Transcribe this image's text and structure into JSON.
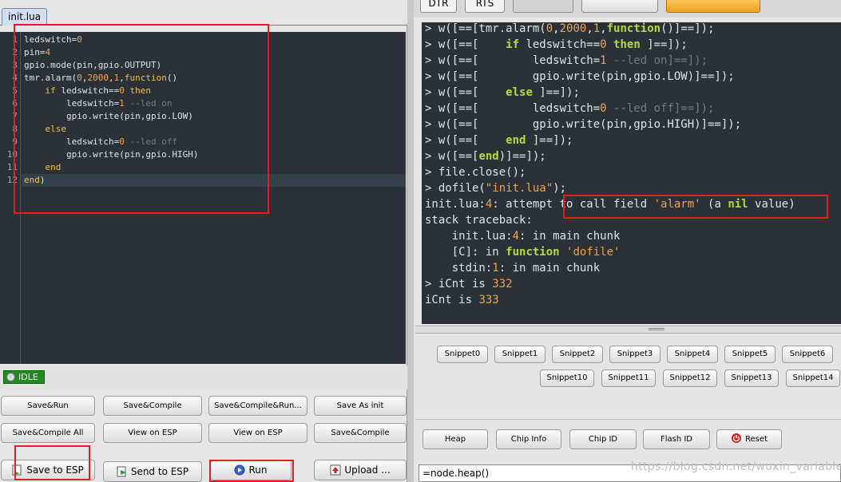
{
  "left": {
    "tab_label": "init.lua",
    "code_lines": [
      {
        "n": "1",
        "parts": [
          {
            "t": "ledswitch=",
            "c": ""
          },
          {
            "t": "0",
            "c": "num"
          }
        ]
      },
      {
        "n": "2",
        "parts": [
          {
            "t": "pin=",
            "c": ""
          },
          {
            "t": "4",
            "c": "num"
          }
        ]
      },
      {
        "n": "3",
        "parts": [
          {
            "t": "gpio.mode(pin,gpio.OUTPUT)",
            "c": ""
          }
        ]
      },
      {
        "n": "4",
        "parts": [
          {
            "t": "tmr.alarm(",
            "c": ""
          },
          {
            "t": "0",
            "c": "num"
          },
          {
            "t": ",",
            "c": ""
          },
          {
            "t": "2000",
            "c": "num"
          },
          {
            "t": ",",
            "c": ""
          },
          {
            "t": "1",
            "c": "num"
          },
          {
            "t": ",",
            "c": ""
          },
          {
            "t": "function",
            "c": "kw"
          },
          {
            "t": "()",
            "c": ""
          }
        ]
      },
      {
        "n": "5",
        "parts": [
          {
            "t": "    ",
            "c": ""
          },
          {
            "t": "if",
            "c": "kw"
          },
          {
            "t": " ledswitch==",
            "c": ""
          },
          {
            "t": "0",
            "c": "num"
          },
          {
            "t": " ",
            "c": ""
          },
          {
            "t": "then",
            "c": "kw"
          }
        ]
      },
      {
        "n": "6",
        "parts": [
          {
            "t": "        ledswitch=",
            "c": ""
          },
          {
            "t": "1",
            "c": "num"
          },
          {
            "t": " --led on",
            "c": "cm"
          }
        ]
      },
      {
        "n": "7",
        "parts": [
          {
            "t": "        gpio.write(pin,gpio.LOW)",
            "c": ""
          }
        ]
      },
      {
        "n": "8",
        "parts": [
          {
            "t": "    ",
            "c": ""
          },
          {
            "t": "else",
            "c": "kw"
          }
        ]
      },
      {
        "n": "9",
        "parts": [
          {
            "t": "        ledswitch=",
            "c": ""
          },
          {
            "t": "0",
            "c": "num"
          },
          {
            "t": " --led off",
            "c": "cm"
          }
        ]
      },
      {
        "n": "10",
        "parts": [
          {
            "t": "        gpio.write(pin,gpio.HIGH)",
            "c": ""
          }
        ]
      },
      {
        "n": "11",
        "parts": [
          {
            "t": "    ",
            "c": ""
          },
          {
            "t": "end",
            "c": "kw"
          }
        ]
      },
      {
        "n": "12",
        "parts": [
          {
            "t": "end",
            "c": "kw"
          },
          {
            "t": ")",
            "c": ""
          }
        ]
      }
    ],
    "status": "IDLE",
    "buttons": {
      "save_run": "Save&Run",
      "save_compile": "Save&Compile",
      "save_compile_run": "Save&Compile&Run...",
      "save_as_init": "Save As init",
      "save_compile_all": "Save&Compile All",
      "view_on_esp_1": "View on ESP",
      "view_on_esp_2": "View on ESP",
      "save_compile_2": "Save&Compile",
      "save_to_esp": "Save to ESP",
      "send_to_esp": "Send to ESP",
      "run": "Run",
      "upload": "Upload ..."
    }
  },
  "right": {
    "top_buttons": {
      "dtr": "DTR",
      "rts": "RTS"
    },
    "console_lines": [
      {
        "parts": [
          {
            "t": "> w([==[tmr.alarm(",
            "c": ""
          },
          {
            "t": "0",
            "c": "nm"
          },
          {
            "t": ",",
            "c": ""
          },
          {
            "t": "2000",
            "c": "nm"
          },
          {
            "t": ",",
            "c": ""
          },
          {
            "t": "1",
            "c": "nm"
          },
          {
            "t": ",",
            "c": ""
          },
          {
            "t": "function",
            "c": "kwb"
          },
          {
            "t": "()]==]);",
            "c": ""
          }
        ]
      },
      {
        "parts": [
          {
            "t": "> w([==[    ",
            "c": ""
          },
          {
            "t": "if",
            "c": "kwb"
          },
          {
            "t": " ledswitch==",
            "c": ""
          },
          {
            "t": "0",
            "c": "nm"
          },
          {
            "t": " ",
            "c": ""
          },
          {
            "t": "then",
            "c": "kwb"
          },
          {
            "t": " ]==]);",
            "c": ""
          }
        ]
      },
      {
        "parts": [
          {
            "t": "> w([==[        ledswitch=",
            "c": ""
          },
          {
            "t": "1",
            "c": "nm"
          },
          {
            "t": " --led on]==]);",
            "c": "gr"
          }
        ]
      },
      {
        "parts": [
          {
            "t": "> w([==[        gpio.write(pin,gpio.LOW)]==]);",
            "c": ""
          }
        ]
      },
      {
        "parts": [
          {
            "t": "> w([==[    ",
            "c": ""
          },
          {
            "t": "else",
            "c": "kwb"
          },
          {
            "t": " ]==]);",
            "c": ""
          }
        ]
      },
      {
        "parts": [
          {
            "t": "> w([==[        ledswitch=",
            "c": ""
          },
          {
            "t": "0",
            "c": "nm"
          },
          {
            "t": " --led off]==]);",
            "c": "gr"
          }
        ]
      },
      {
        "parts": [
          {
            "t": "> w([==[        gpio.write(pin,gpio.HIGH)]==]);",
            "c": ""
          }
        ]
      },
      {
        "parts": [
          {
            "t": "> w([==[    ",
            "c": ""
          },
          {
            "t": "end",
            "c": "kwb"
          },
          {
            "t": " ]==]);",
            "c": ""
          }
        ]
      },
      {
        "parts": [
          {
            "t": "> w([==[",
            "c": ""
          },
          {
            "t": "end",
            "c": "kwb"
          },
          {
            "t": ")]==]);",
            "c": ""
          }
        ]
      },
      {
        "parts": [
          {
            "t": "> file.close();",
            "c": ""
          }
        ]
      },
      {
        "parts": [
          {
            "t": "> dofile(",
            "c": ""
          },
          {
            "t": "\"init.lua\"",
            "c": "str"
          },
          {
            "t": ");",
            "c": ""
          }
        ]
      },
      {
        "parts": [
          {
            "t": "init.lua:",
            "c": ""
          },
          {
            "t": "4",
            "c": "nm"
          },
          {
            "t": ": attempt to call field ",
            "c": ""
          },
          {
            "t": "'alarm'",
            "c": "str"
          },
          {
            "t": " (a ",
            "c": ""
          },
          {
            "t": "nil",
            "c": "nil"
          },
          {
            "t": " value)",
            "c": ""
          }
        ]
      },
      {
        "parts": [
          {
            "t": "stack traceback:",
            "c": ""
          }
        ]
      },
      {
        "parts": [
          {
            "t": "    init.lua:",
            "c": ""
          },
          {
            "t": "4",
            "c": "nm"
          },
          {
            "t": ": in main chunk",
            "c": ""
          }
        ]
      },
      {
        "parts": [
          {
            "t": "    [C]: in ",
            "c": ""
          },
          {
            "t": "function",
            "c": "kwb"
          },
          {
            "t": " ",
            "c": ""
          },
          {
            "t": "'dofile'",
            "c": "str"
          }
        ]
      },
      {
        "parts": [
          {
            "t": "    stdin:",
            "c": ""
          },
          {
            "t": "1",
            "c": "nm"
          },
          {
            "t": ": in main chunk",
            "c": ""
          }
        ]
      },
      {
        "parts": [
          {
            "t": "> iCnt is ",
            "c": ""
          },
          {
            "t": "332",
            "c": "nm"
          }
        ]
      },
      {
        "parts": [
          {
            "t": "iCnt is ",
            "c": ""
          },
          {
            "t": "333",
            "c": "nm"
          }
        ]
      }
    ],
    "snippets_row1": [
      "Snippet0",
      "Snippet1",
      "Snippet2",
      "Snippet3",
      "Snippet4",
      "Snippet5",
      "Snippet6"
    ],
    "snippets_row2": [
      "Snippet10",
      "Snippet11",
      "Snippet12",
      "Snippet13",
      "Snippet14"
    ],
    "bottom_buttons": {
      "heap": "Heap",
      "chip_info": "Chip Info",
      "chip_id": "Chip ID",
      "flash_id": "Flash ID",
      "reset": "Reset"
    },
    "command_value": "=node.heap()",
    "watermark": "https://blog.csdn.net/wuxin_variable"
  },
  "colors": {
    "editor_bg": "#2b3136",
    "highlight_box": "#e02020",
    "status_ok": "#1e8c1e",
    "keyword": "#f0c040",
    "number": "#f2a24a"
  }
}
